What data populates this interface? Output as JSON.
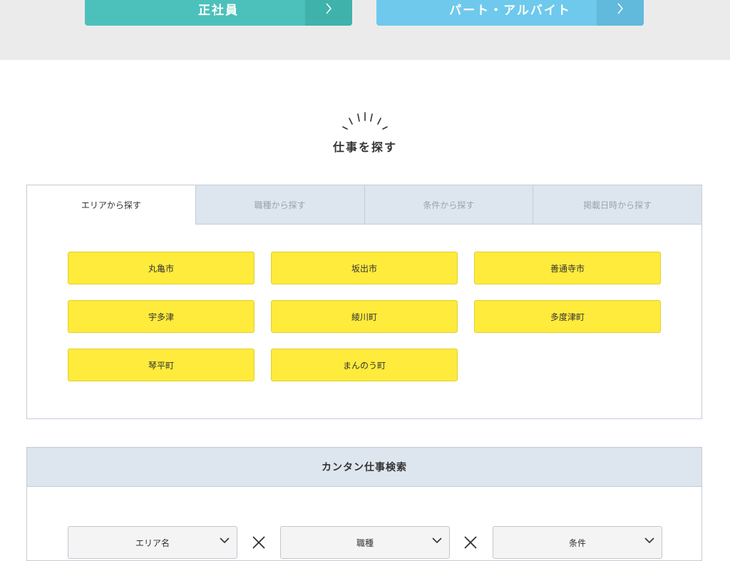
{
  "top_buttons": {
    "fulltime_label": "正社員",
    "parttime_label": "パート・アルバイト"
  },
  "section": {
    "title": "仕事を探す"
  },
  "tabs": [
    {
      "label": "エリアから探す",
      "active": true
    },
    {
      "label": "職種から探す",
      "active": false
    },
    {
      "label": "条件から探す",
      "active": false
    },
    {
      "label": "掲載日時から探す",
      "active": false
    }
  ],
  "areas": [
    "丸亀市",
    "坂出市",
    "善通寺市",
    "宇多津",
    "綾川町",
    "多度津町",
    "琴平町",
    "まんのう町"
  ],
  "quick_search": {
    "title": "カンタン仕事検索",
    "selects": [
      {
        "value": "エリア名"
      },
      {
        "value": "職種"
      },
      {
        "value": "条件"
      }
    ]
  },
  "colors": {
    "fulltime": "#4cc1bb",
    "parttime": "#6ec9ec",
    "area_button": "#ffeb3b",
    "tab_inactive": "#dde5ee"
  },
  "icons": {
    "arrow": "chevron-right-icon",
    "sparkle": "sparkle-icon",
    "select": "chevron-down-icon",
    "combine": "times-icon"
  }
}
